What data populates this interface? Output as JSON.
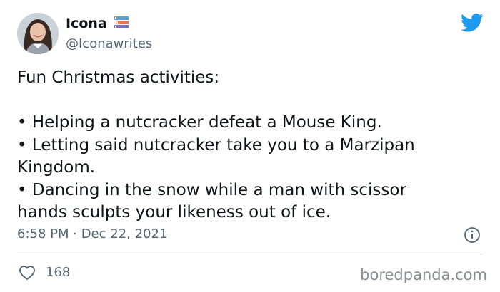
{
  "author": {
    "display_name": "Icona",
    "handle": "@Iconawrites"
  },
  "icons": {
    "avatar": "profile-photo",
    "name_emoji": "books-emoji-icon",
    "logo": "twitter-bird-icon",
    "info": "info-icon",
    "like": "heart-icon"
  },
  "tweet": {
    "lines": [
      "Fun Christmas activities:",
      "",
      "• Helping a nutcracker defeat a Mouse King.",
      "• Letting said nutcracker take you to a Marzipan",
      "Kingdom.",
      "• Dancing in the snow while a man with scissor",
      "hands sculpts your likeness out of ice."
    ],
    "timestamp": "6:58 PM · Dec 22, 2021",
    "like_count": "168"
  },
  "watermark": "boredpanda.com",
  "colors": {
    "twitter_blue": "#1d9bf0",
    "text": "#0f1419",
    "secondary": "#536471",
    "divider": "#cfd9de"
  }
}
